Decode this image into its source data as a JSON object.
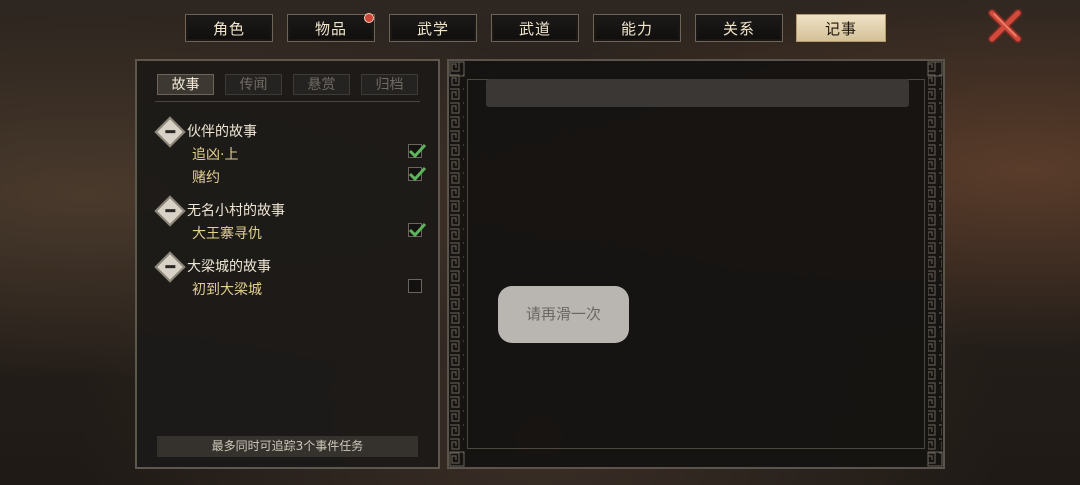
{
  "tabs": [
    {
      "label": "角色",
      "active": false,
      "badge": false
    },
    {
      "label": "物品",
      "active": false,
      "badge": true
    },
    {
      "label": "武学",
      "active": false,
      "badge": false
    },
    {
      "label": "武道",
      "active": false,
      "badge": false
    },
    {
      "label": "能力",
      "active": false,
      "badge": false
    },
    {
      "label": "关系",
      "active": false,
      "badge": false
    },
    {
      "label": "记事",
      "active": true,
      "badge": false
    }
  ],
  "close_icon": "close-x-icon",
  "subtabs": [
    {
      "label": "故事",
      "active": true
    },
    {
      "label": "传闻",
      "active": false
    },
    {
      "label": "悬赏",
      "active": false
    },
    {
      "label": "归档",
      "active": false
    }
  ],
  "groups": [
    {
      "title": "伙伴的故事",
      "quests": [
        {
          "name": "追凶·上",
          "tracked": true
        },
        {
          "name": "赌约",
          "tracked": true
        }
      ]
    },
    {
      "title": "无名小村的故事",
      "quests": [
        {
          "name": "大王寨寻仇",
          "tracked": true
        }
      ]
    },
    {
      "title": "大梁城的故事",
      "quests": [
        {
          "name": "初到大梁城",
          "tracked": false
        }
      ]
    }
  ],
  "track_note": "最多同时可追踪3个事件任务",
  "detail": {
    "title": ""
  },
  "toast": "请再滑一次",
  "colors": {
    "accent": "#e2d08f",
    "check": "#5fb35a",
    "close": "#d24a3c"
  }
}
